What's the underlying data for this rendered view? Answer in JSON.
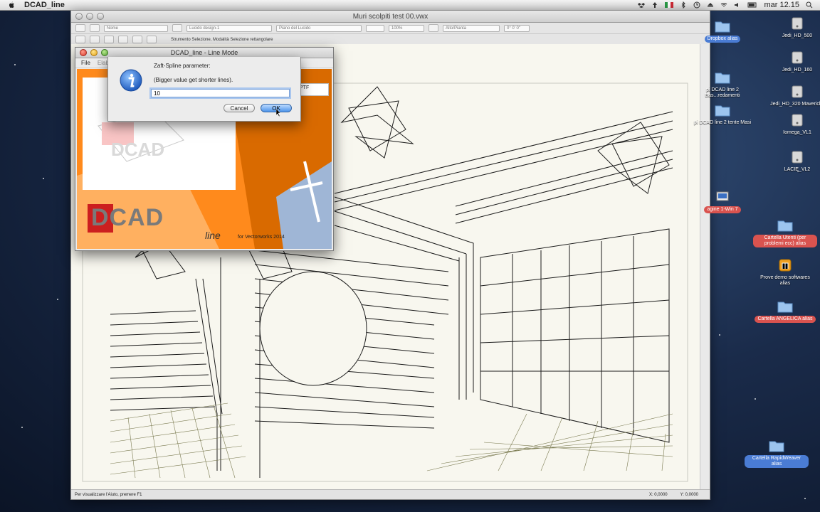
{
  "menubar": {
    "app_name": "DCAD_line",
    "clock": "mar 12.15"
  },
  "main_window": {
    "title": "Muri scolpiti test 00.vwx",
    "toolbar": {
      "class_select": "Nome",
      "layer_select": "Lucido design-1",
      "plane_select": "Piano del Lucido",
      "zoom": "100%",
      "view_select": "Alto/Pianta",
      "rotation": "0° 0' 0\""
    },
    "mode_text": "Strumento Selezione, Modalità Selezione rettangolare",
    "status_message": "Per visualizzare l'Aiuto, premere F1",
    "coord_x": "X: 0,0000",
    "coord_y": "Y: 0,0000"
  },
  "mode_window": {
    "title": "DCAD_line - Line Mode",
    "menu": [
      "File",
      "Elab"
    ],
    "logo_text": "DCAD",
    "logo_sub": "line",
    "logo_caption": "for Vectorworks 2014",
    "side_label": "PTF"
  },
  "dialog": {
    "title": "Zaft-Spline parameter:",
    "message": "(Bigger value get shorter lines).",
    "value": "10",
    "cancel_label": "Cancel",
    "ok_label": "OK"
  },
  "desktop_icons": [
    {
      "label": "Dropbox alias",
      "style": "sel",
      "type": "folder"
    },
    {
      "label": "Jedi_HD_500",
      "style": "plain",
      "type": "drive"
    },
    {
      "label": "Jedi_HD_160",
      "style": "plain",
      "type": "drive"
    },
    {
      "label": "pi DCAD line 2 Bas...redamenti",
      "style": "plain",
      "type": "folder"
    },
    {
      "label": "Jedi_HD_320 Mavericks",
      "style": "plain",
      "type": "drive"
    },
    {
      "label": "pi DCAD line 2 tente Masi",
      "style": "plain",
      "type": "folder"
    },
    {
      "label": "Iomega_VL1",
      "style": "plain",
      "type": "drive"
    },
    {
      "label": "LACIE_VL2",
      "style": "plain",
      "type": "drive"
    },
    {
      "label": "agine 1-Win 7",
      "style": "red",
      "type": "file"
    },
    {
      "label": "Cartella Utenti (per problemi ecc) alias",
      "style": "red",
      "type": "folder"
    },
    {
      "label": "Prove demo softwares alias",
      "style": "plain",
      "type": "app"
    },
    {
      "label": "Cartella ANGELICA alias",
      "style": "red",
      "type": "folder"
    },
    {
      "label": "Cartella RapidWeaver alias",
      "style": "sel",
      "type": "folder"
    }
  ],
  "colors": {
    "desktop_blue": "#1a2b4a",
    "orange": "#ff8a1c",
    "selection_blue": "#4a7cd4",
    "red_label": "#d9534f"
  }
}
